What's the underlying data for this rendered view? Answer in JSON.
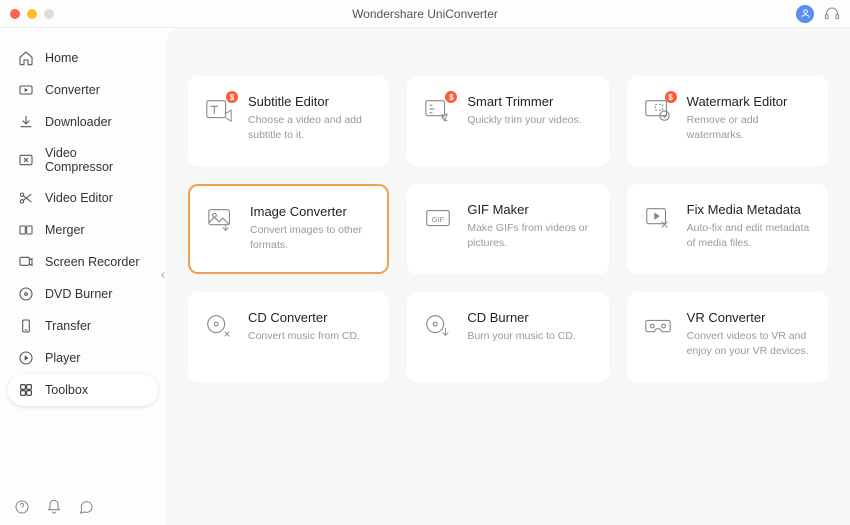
{
  "title": "Wondershare UniConverter",
  "sidebar": {
    "items": [
      {
        "label": "Home"
      },
      {
        "label": "Converter"
      },
      {
        "label": "Downloader"
      },
      {
        "label": "Video Compressor"
      },
      {
        "label": "Video Editor"
      },
      {
        "label": "Merger"
      },
      {
        "label": "Screen Recorder"
      },
      {
        "label": "DVD Burner"
      },
      {
        "label": "Transfer"
      },
      {
        "label": "Player"
      },
      {
        "label": "Toolbox"
      }
    ]
  },
  "badge": "$",
  "cards": {
    "subtitle": {
      "title": "Subtitle Editor",
      "desc": "Choose a video and add subtitle to it."
    },
    "trimmer": {
      "title": "Smart Trimmer",
      "desc": "Quickly trim your videos."
    },
    "watermark": {
      "title": "Watermark Editor",
      "desc": "Remove or add watermarks."
    },
    "image": {
      "title": "Image Converter",
      "desc": "Convert images to other formats."
    },
    "gif": {
      "title": "GIF Maker",
      "desc": "Make GIFs from videos or pictures."
    },
    "metadata": {
      "title": "Fix Media Metadata",
      "desc": "Auto-fix and edit metadata of media files."
    },
    "cdconv": {
      "title": "CD Converter",
      "desc": "Convert music from CD."
    },
    "cdburn": {
      "title": "CD Burner",
      "desc": "Burn your music to CD."
    },
    "vr": {
      "title": "VR Converter",
      "desc": "Convert videos to VR and enjoy on your VR devices."
    }
  }
}
